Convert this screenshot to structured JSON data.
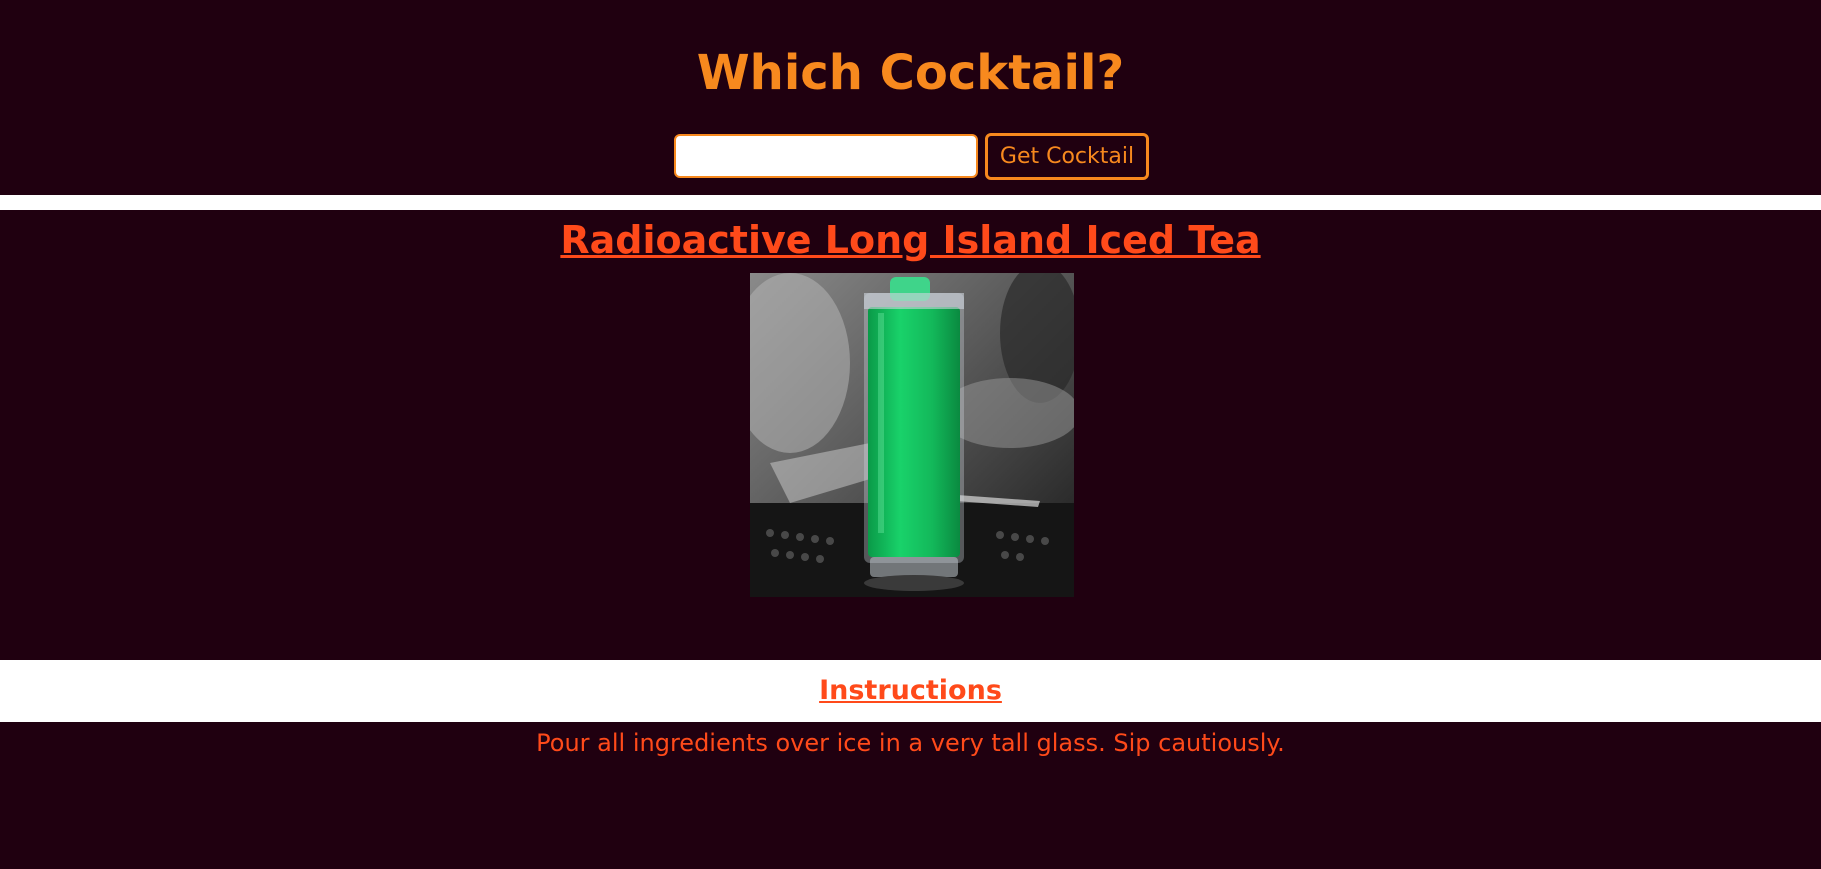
{
  "header": {
    "title": "Which Cocktail?",
    "search_value": "",
    "button_label": "Get Cocktail"
  },
  "drink": {
    "name": "Radioactive Long Island Iced Tea",
    "image_alt": "Radioactive Long Island Iced Tea",
    "instructions_heading": "Instructions",
    "instructions": "Pour all ingredients over ice in a very tall glass. Sip cautiously."
  },
  "colors": {
    "background": "#200010",
    "accent_orange": "#f7891e",
    "heading_red": "#ff4a1a",
    "band_white": "#ffffff",
    "drink_green": "#12c45a"
  }
}
